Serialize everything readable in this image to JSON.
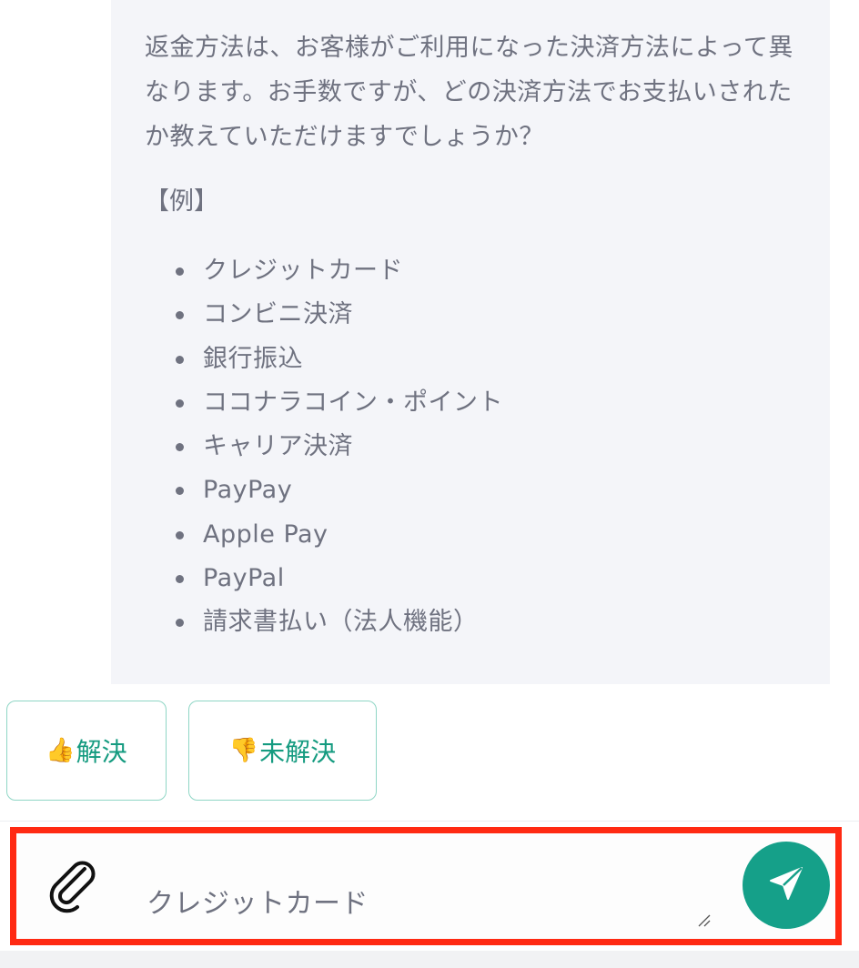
{
  "chat": {
    "bot_message": {
      "paragraph": "返金方法は、お客様がご利用になった決済方法によって異なります。お手数ですが、どの決済方法でお支払いされたか教えていただけますでしょうか？",
      "example_heading": "【例】",
      "methods": [
        "クレジットカード",
        "コンビニ決済",
        "銀行振込",
        "ココナラコイン・ポイント",
        "キャリア決済",
        "PayPay",
        "Apple Pay",
        "PayPal",
        "請求書払い（法人機能）"
      ]
    },
    "feedback": {
      "resolved": {
        "emoji": "👍",
        "label": "解決"
      },
      "unresolved": {
        "emoji": "👎",
        "label": "未解決"
      }
    }
  },
  "composer": {
    "input_value": "クレジットカード",
    "attach_icon": "paperclip-icon",
    "send_icon": "paper-plane-icon",
    "accent_color": "#15a089",
    "highlight_color": "#ff2a13"
  }
}
